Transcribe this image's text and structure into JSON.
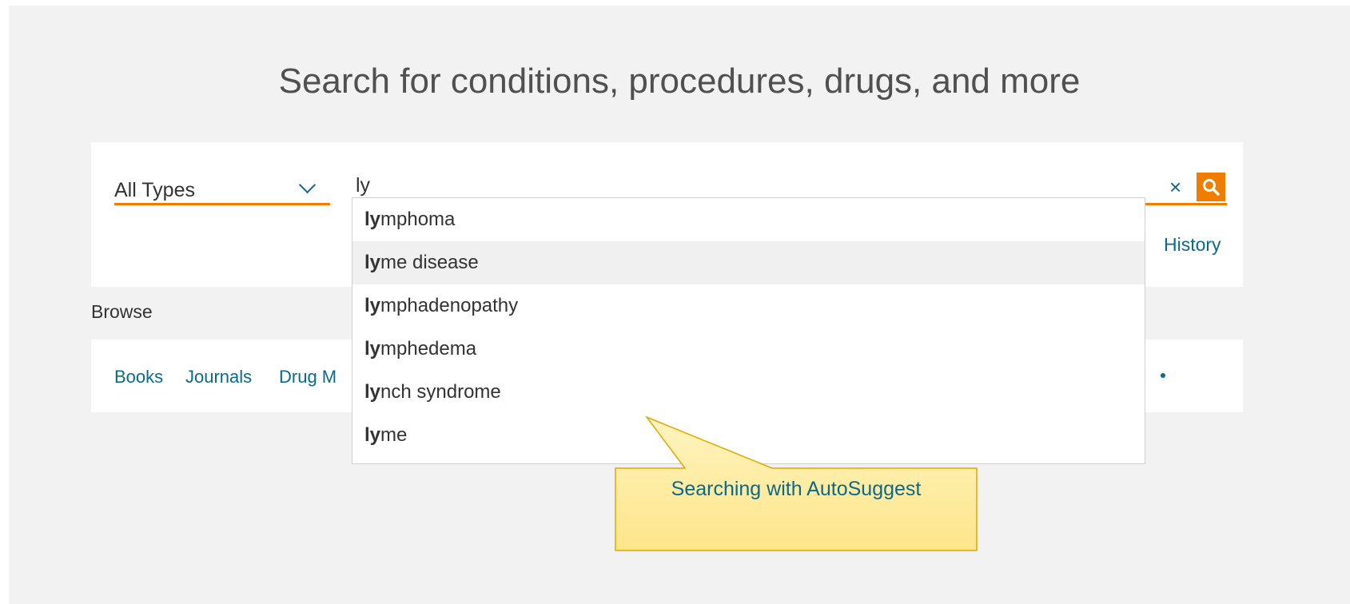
{
  "page": {
    "title": "Search for conditions, procedures, drugs, and more"
  },
  "search": {
    "type_select_value": "All Types",
    "query": "ly",
    "clear_symbol": "×",
    "history_link": "History"
  },
  "suggestions": [
    {
      "match": "ly",
      "rest": "mphoma"
    },
    {
      "match": "ly",
      "rest": "me disease"
    },
    {
      "match": "ly",
      "rest": "mphadenopathy"
    },
    {
      "match": "ly",
      "rest": "mphedema"
    },
    {
      "match": "ly",
      "rest": "nch syndrome"
    },
    {
      "match": "ly",
      "rest": "me"
    }
  ],
  "browse": {
    "heading": "Browse",
    "links": [
      "Books",
      "Journals",
      "Drug M"
    ]
  },
  "callout": {
    "text": "Searching with AutoSuggest"
  },
  "colors": {
    "accent": "#ef7d00",
    "link": "#0a6a8c",
    "callout_fill": "#fde58a",
    "callout_border": "#e0a800"
  }
}
